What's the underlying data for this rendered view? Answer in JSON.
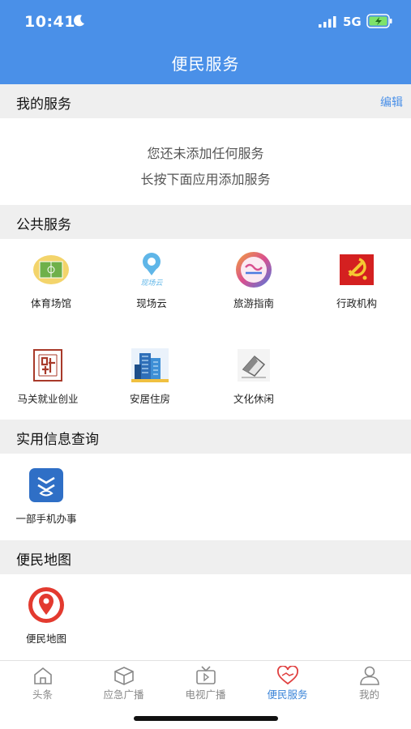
{
  "status_bar": {
    "time": "10:41",
    "network": "5G"
  },
  "header": {
    "title": "便民服务"
  },
  "my_services": {
    "title": "我的服务",
    "edit_label": "编辑",
    "empty_line1": "您还未添加任何服务",
    "empty_line2": "长按下面应用添加服务"
  },
  "public_services": {
    "title": "公共服务",
    "items": [
      {
        "label": "体育场馆",
        "icon": "stadium-icon"
      },
      {
        "label": "现场云",
        "icon": "cloud-live-icon"
      },
      {
        "label": "旅游指南",
        "icon": "travel-guide-icon"
      },
      {
        "label": "行政机构",
        "icon": "party-emblem-icon"
      },
      {
        "label": "马关就业创业",
        "icon": "employment-seal-icon"
      },
      {
        "label": "安居住房",
        "icon": "building-icon"
      },
      {
        "label": "文化休闲",
        "icon": "eraser-icon"
      }
    ]
  },
  "info_query": {
    "title": "实用信息查询",
    "items": [
      {
        "label": "一部手机办事",
        "icon": "mobile-affairs-icon"
      }
    ]
  },
  "convenience_map": {
    "title": "便民地图",
    "items": [
      {
        "label": "便民地图",
        "icon": "map-pin-icon"
      }
    ]
  },
  "tab_bar": {
    "items": [
      {
        "label": "头条",
        "icon": "home-icon"
      },
      {
        "label": "应急广播",
        "icon": "box-icon"
      },
      {
        "label": "电视广播",
        "icon": "tv-icon"
      },
      {
        "label": "便民服务",
        "icon": "handshake-heart-icon"
      },
      {
        "label": "我的",
        "icon": "user-icon"
      }
    ],
    "active_index": 3
  },
  "colors": {
    "primary": "#4a90e8",
    "section_bg": "#efefef",
    "active_tab": "#3a84d8"
  }
}
